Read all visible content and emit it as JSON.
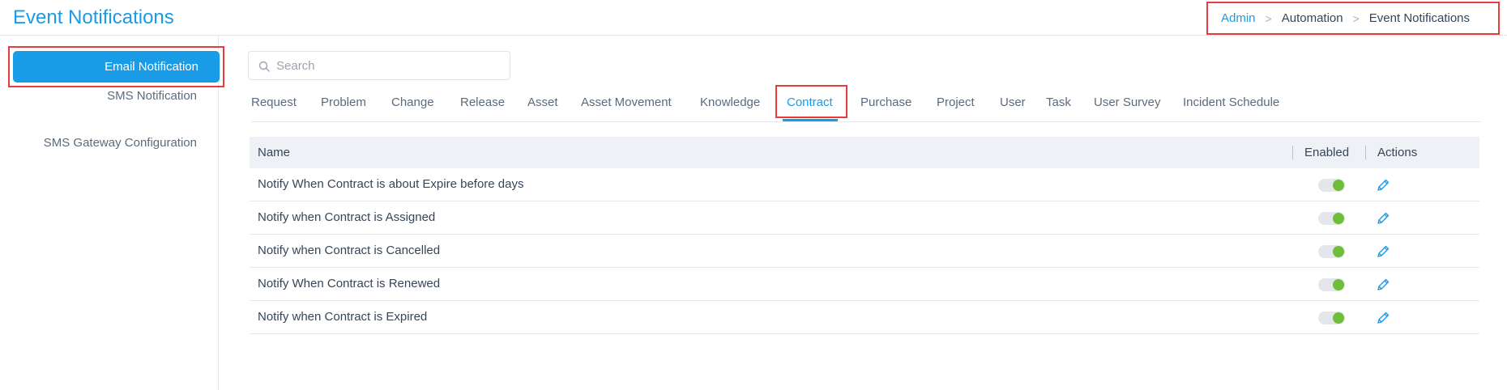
{
  "header": {
    "title": "Event Notifications",
    "breadcrumb": [
      "Admin",
      "Automation",
      "Event Notifications"
    ]
  },
  "sidebar": {
    "items": [
      {
        "label": "Email Notification",
        "active": true
      },
      {
        "label": "SMS Notification",
        "active": false
      },
      {
        "label": "SMS Gateway Configuration",
        "active": false
      }
    ]
  },
  "search": {
    "placeholder": "Search",
    "value": ""
  },
  "tabs": [
    {
      "label": "Request"
    },
    {
      "label": "Problem"
    },
    {
      "label": "Change"
    },
    {
      "label": "Release"
    },
    {
      "label": "Asset"
    },
    {
      "label": "Asset Movement"
    },
    {
      "label": "Knowledge"
    },
    {
      "label": "Contract",
      "active": true
    },
    {
      "label": "Purchase"
    },
    {
      "label": "Project"
    },
    {
      "label": "User"
    },
    {
      "label": "Task"
    },
    {
      "label": "User Survey"
    },
    {
      "label": "Incident Schedule"
    }
  ],
  "table": {
    "columns": {
      "name": "Name",
      "enabled": "Enabled",
      "actions": "Actions"
    },
    "rows": [
      {
        "name": "Notify When Contract is about Expire before days",
        "enabled": true
      },
      {
        "name": "Notify when Contract is Assigned",
        "enabled": true
      },
      {
        "name": "Notify when Contract is Cancelled",
        "enabled": true
      },
      {
        "name": "Notify When Contract is Renewed",
        "enabled": true
      },
      {
        "name": "Notify when Contract is Expired",
        "enabled": true
      }
    ]
  },
  "icons": {
    "search": "search-icon",
    "breadcrumb_separator": "chevron-right-icon",
    "edit": "pencil-icon"
  },
  "colors": {
    "accent": "#1a9be6",
    "highlight": "#e83b3b",
    "toggle_on": "#6fbe3a"
  }
}
